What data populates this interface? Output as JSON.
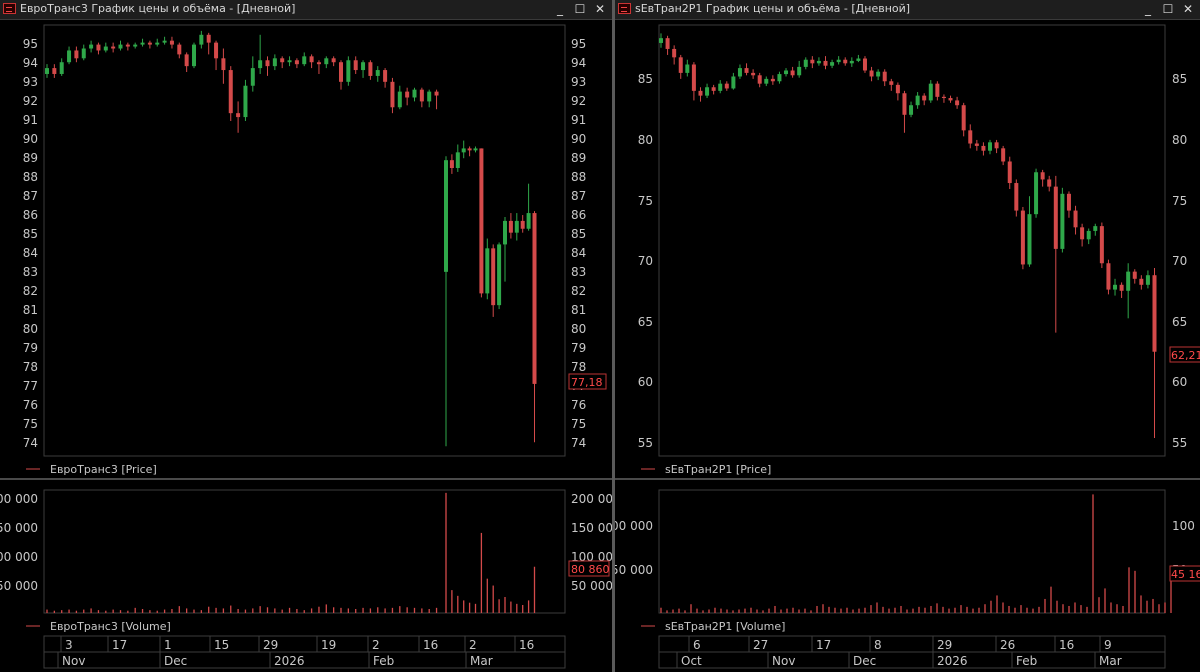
{
  "windows": [
    {
      "title": "ЕвроТранс3 График цены и объёма - [Дневной]",
      "price_legend": "ЕвроТранс3 [Price]",
      "volume_legend": "ЕвроТранс3 [Volume]",
      "last_price_label": "77,18",
      "last_volume_label": "80 860",
      "price_ticks": [
        "95",
        "94",
        "93",
        "92",
        "91",
        "90",
        "89",
        "88",
        "87",
        "86",
        "85",
        "84",
        "83",
        "82",
        "81",
        "80",
        "79",
        "78",
        "77",
        "76",
        "75",
        "74"
      ],
      "volume_ticks_left": [
        "200 000",
        "150 000",
        "100 000",
        "50 000"
      ],
      "volume_ticks_right": [
        "200 000",
        "150 000",
        "100 000",
        "50 000"
      ],
      "date_ticks": [
        "3",
        "17",
        "1",
        "15",
        "29",
        "19",
        "2",
        "16",
        "2",
        "16"
      ],
      "month_ticks": [
        "Nov",
        "Dec",
        "2026",
        "Feb",
        "Mar"
      ],
      "controls": {
        "minimize": "_",
        "maximize": "☐",
        "close": "✕"
      }
    },
    {
      "title": "sЕвТран2Р1 График цены и объёма - [Дневной]",
      "price_legend": "sЕвТран2Р1 [Price]",
      "volume_legend": "sЕвТран2Р1 [Volume]",
      "last_price_label": "62,21",
      "last_volume_label": "45 16",
      "price_ticks": [
        "85",
        "80",
        "75",
        "70",
        "65",
        "60",
        "55"
      ],
      "volume_ticks_left": [
        "00 000",
        "50 000"
      ],
      "volume_ticks_right": [
        "100",
        "50"
      ],
      "date_ticks": [
        "6",
        "27",
        "17",
        "8",
        "29",
        "26",
        "16",
        "9"
      ],
      "month_ticks": [
        "Oct",
        "Nov",
        "Dec",
        "2026",
        "Feb",
        "Mar"
      ],
      "controls": {
        "minimize": "_",
        "maximize": "☐",
        "close": "✕"
      }
    }
  ],
  "colors": {
    "up": "#2fa84a",
    "down": "#d44a4a",
    "grid": "#2a2a2a",
    "frame": "#3c3c3c",
    "background": "#000000"
  },
  "chart_data": [
    {
      "type": "candlestick",
      "title": "ЕвроТранс3 График цены и объёма - [Дневной]",
      "series_name": "ЕвроТранс3 [Price]",
      "ylim": [
        73.5,
        95.5
      ],
      "x_range": [
        "2025-10-27",
        "2026-03-20"
      ],
      "last_value": 77.18,
      "candles": [
        [
          93.0,
          93.3,
          93.5,
          92.8
        ],
        [
          93.3,
          93.0,
          93.5,
          92.8
        ],
        [
          93.0,
          93.6,
          93.8,
          92.9
        ],
        [
          93.6,
          94.2,
          94.4,
          93.5
        ],
        [
          94.2,
          93.8,
          94.4,
          93.6
        ],
        [
          93.8,
          94.3,
          94.5,
          93.7
        ],
        [
          94.3,
          94.5,
          94.7,
          94.1
        ],
        [
          94.5,
          94.2,
          94.6,
          94.0
        ],
        [
          94.2,
          94.4,
          94.6,
          94.1
        ],
        [
          94.4,
          94.3,
          94.6,
          94.1
        ],
        [
          94.3,
          94.5,
          94.7,
          94.2
        ],
        [
          94.5,
          94.4,
          94.6,
          94.2
        ],
        [
          94.4,
          94.5,
          94.6,
          94.3
        ],
        [
          94.5,
          94.6,
          94.8,
          94.4
        ],
        [
          94.6,
          94.5,
          94.7,
          94.3
        ],
        [
          94.5,
          94.6,
          94.8,
          94.4
        ],
        [
          94.6,
          94.7,
          94.9,
          94.5
        ],
        [
          94.7,
          94.5,
          94.9,
          94.3
        ],
        [
          94.5,
          94.0,
          94.6,
          93.8
        ],
        [
          94.0,
          93.4,
          94.1,
          93.1
        ],
        [
          93.4,
          94.5,
          94.6,
          93.3
        ],
        [
          94.5,
          95.0,
          95.2,
          94.3
        ],
        [
          95.0,
          94.6,
          95.1,
          94.0
        ],
        [
          94.6,
          93.8,
          94.7,
          93.2
        ],
        [
          93.8,
          93.2,
          94.3,
          92.5
        ],
        [
          93.2,
          91.0,
          93.4,
          90.6
        ],
        [
          91.0,
          90.8,
          91.6,
          90.0
        ],
        [
          90.8,
          92.4,
          92.7,
          90.6
        ],
        [
          92.4,
          93.3,
          93.9,
          92.1
        ],
        [
          93.3,
          93.7,
          95.0,
          93.0
        ],
        [
          93.7,
          93.4,
          93.9,
          92.9
        ],
        [
          93.4,
          93.8,
          94.0,
          93.2
        ],
        [
          93.8,
          93.6,
          93.9,
          93.3
        ],
        [
          93.6,
          93.7,
          93.9,
          93.4
        ],
        [
          93.7,
          93.5,
          93.8,
          93.3
        ],
        [
          93.5,
          93.9,
          94.1,
          93.4
        ],
        [
          93.9,
          93.6,
          94.0,
          93.3
        ],
        [
          93.6,
          93.5,
          93.7,
          93.0
        ],
        [
          93.5,
          93.8,
          93.9,
          93.3
        ],
        [
          93.8,
          93.6,
          93.9,
          93.4
        ],
        [
          93.6,
          92.6,
          93.7,
          92.2
        ],
        [
          92.6,
          93.7,
          93.9,
          92.4
        ],
        [
          93.7,
          93.2,
          93.9,
          93.0
        ],
        [
          93.2,
          93.6,
          93.7,
          92.8
        ],
        [
          93.6,
          92.9,
          93.7,
          92.7
        ],
        [
          92.9,
          93.2,
          93.4,
          92.6
        ],
        [
          93.2,
          92.6,
          93.3,
          92.3
        ],
        [
          92.6,
          91.3,
          92.8,
          91.0
        ],
        [
          91.3,
          92.1,
          92.4,
          91.2
        ],
        [
          92.1,
          91.8,
          92.3,
          91.4
        ],
        [
          91.8,
          92.2,
          92.3,
          91.6
        ],
        [
          92.2,
          91.6,
          92.3,
          91.3
        ],
        [
          91.6,
          92.1,
          92.2,
          91.3
        ],
        [
          92.1,
          91.9,
          92.2,
          91.2
        ],
        [
          82.9,
          88.6,
          88.8,
          74.0
        ],
        [
          88.6,
          88.2,
          88.9,
          87.9
        ],
        [
          88.2,
          89.0,
          89.4,
          88.0
        ],
        [
          89.0,
          89.2,
          89.6,
          88.7
        ],
        [
          89.2,
          89.1,
          89.3,
          88.8
        ],
        [
          89.1,
          89.2,
          89.3,
          89.0
        ],
        [
          89.2,
          81.8,
          89.2,
          81.6
        ],
        [
          81.8,
          84.1,
          84.6,
          81.5
        ],
        [
          84.1,
          81.2,
          84.3,
          80.6
        ],
        [
          81.2,
          84.3,
          84.4,
          81.0
        ],
        [
          84.3,
          85.5,
          85.7,
          82.4
        ],
        [
          85.5,
          84.9,
          85.9,
          84.6
        ],
        [
          84.9,
          85.5,
          85.9,
          84.5
        ],
        [
          85.5,
          85.1,
          85.8,
          84.9
        ],
        [
          85.1,
          85.9,
          87.4,
          85.0
        ],
        [
          85.9,
          77.18,
          86.0,
          74.2
        ]
      ],
      "volume_ylim": [
        0,
        215000
      ],
      "volume": [
        6000,
        4000,
        5000,
        6000,
        4000,
        6000,
        8000,
        5000,
        4000,
        6000,
        5000,
        4000,
        9000,
        7000,
        5000,
        4000,
        6000,
        7000,
        12000,
        8000,
        6000,
        5000,
        11000,
        9000,
        8000,
        13000,
        7000,
        6000,
        8000,
        12000,
        10000,
        8000,
        6000,
        9000,
        7000,
        5000,
        8000,
        11000,
        15000,
        10000,
        9000,
        8000,
        7000,
        9000,
        8000,
        10000,
        8000,
        9000,
        12000,
        10000,
        9000,
        8000,
        7000,
        9000,
        210000,
        40000,
        30000,
        22000,
        18000,
        16000,
        140000,
        60000,
        48000,
        24000,
        28000,
        20000,
        16000,
        14000,
        22000,
        80860
      ]
    },
    {
      "type": "candlestick",
      "title": "sЕвТран2Р1 График цены и объёма - [Дневной]",
      "series_name": "sЕвТран2Р1 [Price]",
      "ylim": [
        53.5,
        89.5
      ],
      "x_range": [
        "2025-09-29",
        "2026-03-20"
      ],
      "last_value": 62.21,
      "candles": [
        [
          88.0,
          88.4,
          88.8,
          87.6
        ],
        [
          88.4,
          87.5,
          88.6,
          87.0
        ],
        [
          87.5,
          86.8,
          87.8,
          86.2
        ],
        [
          86.8,
          85.5,
          87.0,
          85.0
        ],
        [
          85.5,
          86.2,
          86.6,
          85.2
        ],
        [
          86.2,
          84.0,
          86.4,
          83.2
        ],
        [
          84.0,
          83.6,
          84.3,
          83.1
        ],
        [
          83.6,
          84.3,
          84.6,
          83.4
        ],
        [
          84.3,
          84.0,
          84.5,
          83.7
        ],
        [
          84.0,
          84.6,
          84.9,
          83.8
        ],
        [
          84.6,
          84.2,
          84.8,
          84.0
        ],
        [
          84.2,
          85.2,
          85.5,
          84.1
        ],
        [
          85.2,
          85.9,
          86.2,
          85.0
        ],
        [
          85.9,
          85.5,
          86.3,
          85.3
        ],
        [
          85.5,
          85.3,
          85.8,
          85.0
        ],
        [
          85.3,
          84.6,
          85.5,
          84.3
        ],
        [
          84.6,
          85.0,
          85.2,
          84.4
        ],
        [
          85.0,
          84.8,
          85.3,
          84.5
        ],
        [
          84.8,
          85.4,
          85.6,
          84.6
        ],
        [
          85.4,
          85.7,
          85.9,
          85.2
        ],
        [
          85.7,
          85.3,
          86.0,
          85.1
        ],
        [
          85.3,
          86.0,
          86.5,
          85.1
        ],
        [
          86.0,
          86.6,
          86.8,
          85.8
        ],
        [
          86.6,
          86.3,
          86.9,
          85.9
        ],
        [
          86.3,
          86.5,
          86.8,
          86.1
        ],
        [
          86.5,
          86.1,
          86.9,
          85.8
        ],
        [
          86.1,
          86.4,
          86.6,
          85.9
        ],
        [
          86.4,
          86.6,
          86.9,
          86.2
        ],
        [
          86.6,
          86.3,
          86.8,
          86.1
        ],
        [
          86.3,
          86.5,
          86.8,
          86.0
        ],
        [
          86.5,
          86.7,
          87.0,
          86.4
        ],
        [
          86.7,
          85.7,
          86.9,
          85.5
        ],
        [
          85.7,
          85.2,
          86.0,
          84.8
        ],
        [
          85.2,
          85.6,
          85.8,
          84.9
        ],
        [
          85.6,
          84.8,
          85.8,
          84.4
        ],
        [
          84.8,
          84.5,
          85.0,
          84.0
        ],
        [
          84.5,
          83.8,
          84.7,
          83.2
        ],
        [
          83.8,
          82.0,
          84.0,
          80.5
        ],
        [
          82.0,
          82.8,
          83.1,
          81.8
        ],
        [
          82.8,
          83.6,
          83.9,
          82.5
        ],
        [
          83.6,
          83.2,
          83.8,
          82.8
        ],
        [
          83.2,
          84.6,
          84.9,
          83.0
        ],
        [
          84.6,
          83.5,
          84.8,
          83.2
        ],
        [
          83.5,
          83.4,
          83.7,
          83.0
        ],
        [
          83.4,
          83.2,
          83.6,
          83.0
        ],
        [
          83.2,
          82.8,
          83.5,
          82.5
        ],
        [
          82.8,
          80.7,
          83.0,
          80.2
        ],
        [
          80.7,
          79.6,
          81.2,
          79.2
        ],
        [
          79.6,
          79.4,
          79.9,
          79.0
        ],
        [
          79.4,
          79.0,
          79.7,
          78.6
        ],
        [
          79.0,
          79.7,
          79.9,
          78.7
        ],
        [
          79.7,
          79.2,
          79.9,
          78.8
        ],
        [
          79.2,
          78.1,
          79.4,
          77.8
        ],
        [
          78.1,
          76.3,
          78.5,
          75.8
        ],
        [
          76.3,
          74.0,
          76.6,
          73.5
        ],
        [
          74.0,
          69.5,
          74.3,
          69.1
        ],
        [
          69.5,
          73.7,
          75.2,
          69.3
        ],
        [
          73.7,
          77.2,
          77.5,
          73.4
        ],
        [
          77.2,
          76.6,
          77.4,
          76.0
        ],
        [
          76.6,
          76.0,
          76.9,
          75.6
        ],
        [
          76.0,
          70.8,
          76.9,
          63.8
        ],
        [
          70.8,
          75.4,
          75.9,
          70.5
        ],
        [
          75.4,
          74.0,
          75.6,
          73.4
        ],
        [
          74.0,
          72.6,
          74.4,
          72.0
        ],
        [
          72.6,
          71.6,
          72.9,
          71.0
        ],
        [
          71.6,
          72.3,
          72.5,
          71.2
        ],
        [
          72.3,
          72.7,
          72.9,
          71.9
        ],
        [
          72.7,
          69.6,
          73.0,
          69.2
        ],
        [
          69.6,
          67.4,
          69.9,
          67.0
        ],
        [
          67.4,
          67.8,
          68.3,
          66.9
        ],
        [
          67.8,
          67.3,
          68.0,
          66.7
        ],
        [
          67.3,
          68.9,
          69.6,
          65.0
        ],
        [
          68.9,
          68.3,
          69.1,
          67.9
        ],
        [
          68.3,
          67.8,
          68.6,
          67.4
        ],
        [
          67.8,
          68.6,
          69.0,
          67.5
        ],
        [
          68.6,
          62.21,
          69.2,
          55.0
        ]
      ],
      "volume_ylim": [
        0,
        140000
      ],
      "volume": [
        6000,
        3000,
        4000,
        5000,
        3000,
        10000,
        5000,
        3000,
        4000,
        6000,
        5000,
        4000,
        3000,
        4000,
        5000,
        6000,
        4000,
        3000,
        5000,
        8000,
        4000,
        5000,
        6000,
        4000,
        5000,
        3000,
        8000,
        10000,
        7000,
        6000,
        5000,
        6000,
        4000,
        5000,
        6000,
        9000,
        12000,
        7000,
        5000,
        6000,
        8000,
        4000,
        5000,
        7000,
        6000,
        8000,
        11000,
        7000,
        5000,
        6000,
        9000,
        7000,
        5000,
        6000,
        10000,
        14000,
        20000,
        12000,
        8000,
        6000,
        9000,
        6000,
        5000,
        7000,
        16000,
        30000,
        14000,
        10000,
        8000,
        12000,
        9000,
        7000,
        135000,
        18000,
        28000,
        12000,
        10000,
        8000,
        52000,
        48000,
        20000,
        14000,
        16000,
        10000,
        12000,
        45160
      ]
    }
  ]
}
